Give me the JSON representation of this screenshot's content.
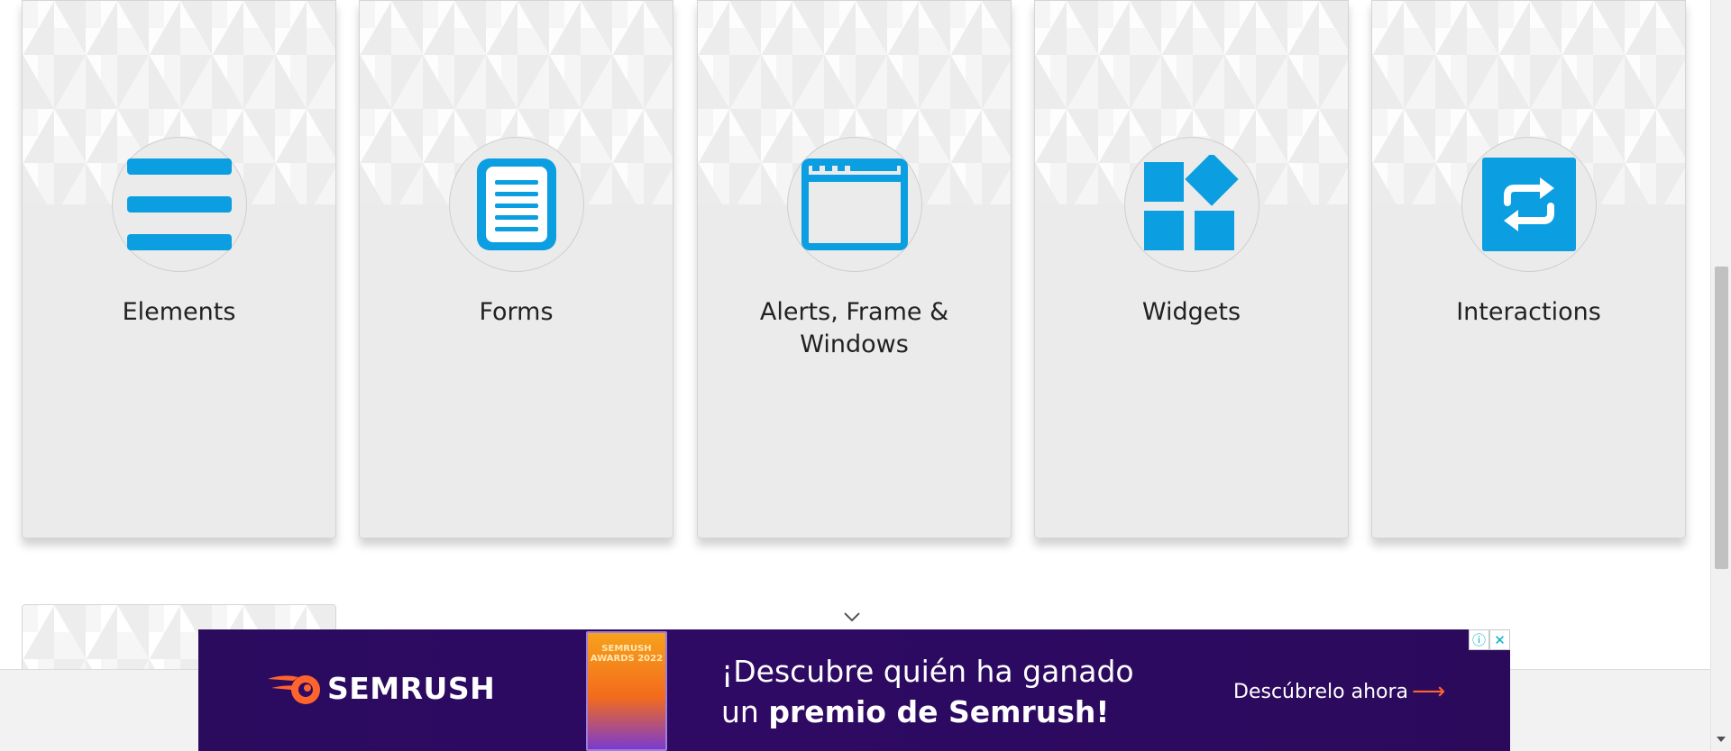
{
  "cards": [
    {
      "title": "Elements",
      "icon": "hamburger-menu-icon"
    },
    {
      "title": "Forms",
      "icon": "document-form-icon"
    },
    {
      "title": "Alerts, Frame & Windows",
      "icon": "browser-window-icon"
    },
    {
      "title": "Widgets",
      "icon": "widgets-blocks-icon"
    },
    {
      "title": "Interactions",
      "icon": "swap-arrows-icon"
    }
  ],
  "colors": {
    "icon_blue": "#0b9ee0",
    "card_bg": "#ebebeb",
    "ad_bg": "#2e0a64",
    "semrush_orange": "#ff642d"
  },
  "ad": {
    "brand": "SEMRUSH",
    "trophy_label": "SEMRUSH AWARDS 2022",
    "headline_line1": "¡Descubre quién ha ganado",
    "headline_line2_prefix": "un ",
    "headline_line2_bold": "premio de Semrush!",
    "cta": "Descúbrelo ahora",
    "cta_arrow": "⟶",
    "info_badge": "ⓘ",
    "close_badge": "✕"
  }
}
